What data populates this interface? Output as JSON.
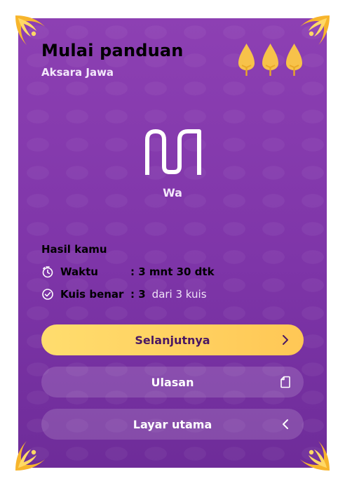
{
  "header": {
    "title": "Mulai panduan",
    "subtitle": "Aksara Jawa",
    "lives_count": 3,
    "lives_icon": "gunungan-icon"
  },
  "character": {
    "glyph_icon": "aksara-wa-icon",
    "label": "Wa"
  },
  "results": {
    "title": "Hasil kamu",
    "time": {
      "icon": "timer-icon",
      "label": "Waktu",
      "value": ": 3 mnt 30 dtk"
    },
    "quiz": {
      "icon": "check-circle-icon",
      "label": "Kuis benar",
      "value": ": 3",
      "suffix": "dari 3 kuis"
    }
  },
  "buttons": {
    "next": {
      "label": "Selanjutnya",
      "icon": "chevron-right-icon"
    },
    "review": {
      "label": "Ulasan",
      "icon": "document-icon"
    },
    "home": {
      "label": "Layar utama",
      "icon": "chevron-left-icon"
    }
  },
  "colors": {
    "card_background": "#8a3db0",
    "accent_yellow": "#ffd25e",
    "ornament_gold": "#f7b52c",
    "button_text_dark": "#4a1863"
  }
}
